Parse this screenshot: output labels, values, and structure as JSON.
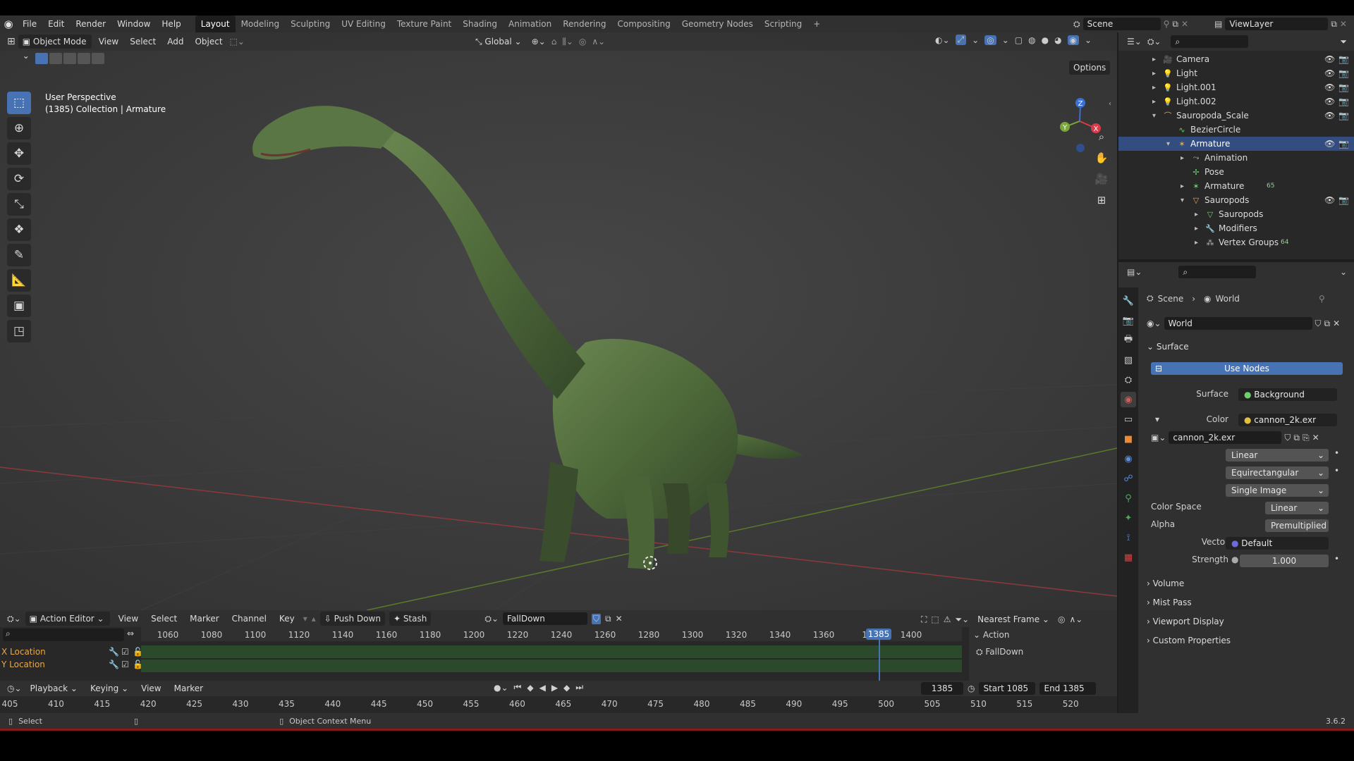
{
  "topbar": {
    "menus": [
      "File",
      "Edit",
      "Render",
      "Window",
      "Help"
    ],
    "workspaces": [
      "Layout",
      "Modeling",
      "Sculpting",
      "UV Editing",
      "Texture Paint",
      "Shading",
      "Animation",
      "Rendering",
      "Compositing",
      "Geometry Nodes",
      "Scripting"
    ],
    "active_workspace": "Layout",
    "add_tab": "+",
    "scene": "Scene",
    "view_layer": "ViewLayer"
  },
  "viewport": {
    "mode": "Object Mode",
    "menus": [
      "View",
      "Select",
      "Add",
      "Object"
    ],
    "orientation": "Global",
    "options": "Options",
    "overlay_title": "User Perspective",
    "overlay_subtitle": "(1385) Collection | Armature",
    "gizmo_axes": [
      "Z",
      "Y",
      "X"
    ]
  },
  "outliner": {
    "search_placeholder": "",
    "items": [
      {
        "label": "Camera",
        "icon": "camera-icon",
        "indent": 0,
        "expand": "▸",
        "vis": true
      },
      {
        "label": "Light",
        "icon": "light-icon",
        "indent": 0,
        "expand": "▸",
        "vis": true
      },
      {
        "label": "Light.001",
        "icon": "light-icon",
        "indent": 0,
        "expand": "▸",
        "vis": true
      },
      {
        "label": "Light.002",
        "icon": "light-icon",
        "indent": 0,
        "expand": "▸",
        "vis": true
      },
      {
        "label": "Sauropoda_Scale",
        "icon": "curve-icon",
        "indent": 0,
        "expand": "▾",
        "vis": true
      },
      {
        "label": "BezierCircle",
        "icon": "curve-data-icon",
        "indent": 1,
        "expand": "",
        "vis": false
      },
      {
        "label": "Armature",
        "icon": "armature-icon",
        "indent": 1,
        "expand": "▾",
        "vis": true,
        "selected": true
      },
      {
        "label": "Animation",
        "icon": "animation-icon",
        "indent": 2,
        "expand": "▸",
        "vis": false
      },
      {
        "label": "Pose",
        "icon": "pose-icon",
        "indent": 2,
        "expand": "",
        "vis": false
      },
      {
        "label": "Armature",
        "icon": "armature-data-icon",
        "indent": 2,
        "expand": "▸",
        "vis": false,
        "badge": "65"
      },
      {
        "label": "Sauropods",
        "icon": "mesh-object-icon",
        "indent": 2,
        "expand": "▾",
        "vis": true
      },
      {
        "label": "Sauropods",
        "icon": "mesh-data-icon",
        "indent": 3,
        "expand": "▸",
        "vis": false
      },
      {
        "label": "Modifiers",
        "icon": "modifier-icon",
        "indent": 3,
        "expand": "▸",
        "vis": false
      },
      {
        "label": "Vertex Groups",
        "icon": "vertex-group-icon",
        "indent": 3,
        "expand": "▸",
        "vis": false,
        "badge": "64"
      }
    ]
  },
  "properties": {
    "breadcrumb": [
      "Scene",
      "World"
    ],
    "world_name": "World",
    "surface_panel": "Surface",
    "use_nodes": "Use Nodes",
    "surface_label": "Surface",
    "surface_value": "Background",
    "color_label": "Color",
    "color_value": "cannon_2k.exr",
    "image_name": "cannon_2k.exr",
    "interpolation": "Linear",
    "projection": "Equirectangular",
    "source": "Single Image",
    "color_space_label": "Color Space",
    "color_space_value": "Linear",
    "alpha_label": "Alpha",
    "alpha_value": "Premultiplied",
    "vector_label": "Vector",
    "vector_value": "Default",
    "strength_label": "Strength",
    "strength_value": "1.000",
    "collapsed_panels": [
      "Volume",
      "Mist Pass",
      "Viewport Display",
      "Custom Properties"
    ]
  },
  "dopesheet": {
    "editor": "Action Editor",
    "menus": [
      "View",
      "Select",
      "Marker",
      "Channel",
      "Key"
    ],
    "push_down": "Push Down",
    "stash": "Stash",
    "action_name": "FallDown",
    "snap": "Nearest Frame",
    "ruler": [
      "1060",
      "1080",
      "1100",
      "1120",
      "1140",
      "1160",
      "1180",
      "1200",
      "1220",
      "1240",
      "1260",
      "1280",
      "1300",
      "1320",
      "1340",
      "1360",
      "13",
      "1400"
    ],
    "current_frame": "1385",
    "channels": [
      "X Location",
      "Y Location"
    ],
    "sidebar_panel": "Action",
    "sidebar_action": "FallDown"
  },
  "timeline": {
    "menus": [
      "Playback",
      "Keying",
      "View",
      "Marker"
    ],
    "frame": "1385",
    "start_label": "Start",
    "start": "1085",
    "end_label": "End",
    "end": "1385",
    "ruler": [
      "405",
      "410",
      "415",
      "420",
      "425",
      "430",
      "435",
      "440",
      "445",
      "450",
      "455",
      "460",
      "465",
      "470",
      "475",
      "480",
      "485",
      "490",
      "495",
      "500",
      "505",
      "510",
      "515",
      "520"
    ]
  },
  "statusbar": {
    "left": "Select",
    "middle": "Object Context Menu",
    "version": "3.6.2"
  },
  "colors": {
    "accent": "#4772b3",
    "selected_row": "#334d80",
    "keyframe_band": "#2b4a2b",
    "playhead": "#4772b3"
  }
}
